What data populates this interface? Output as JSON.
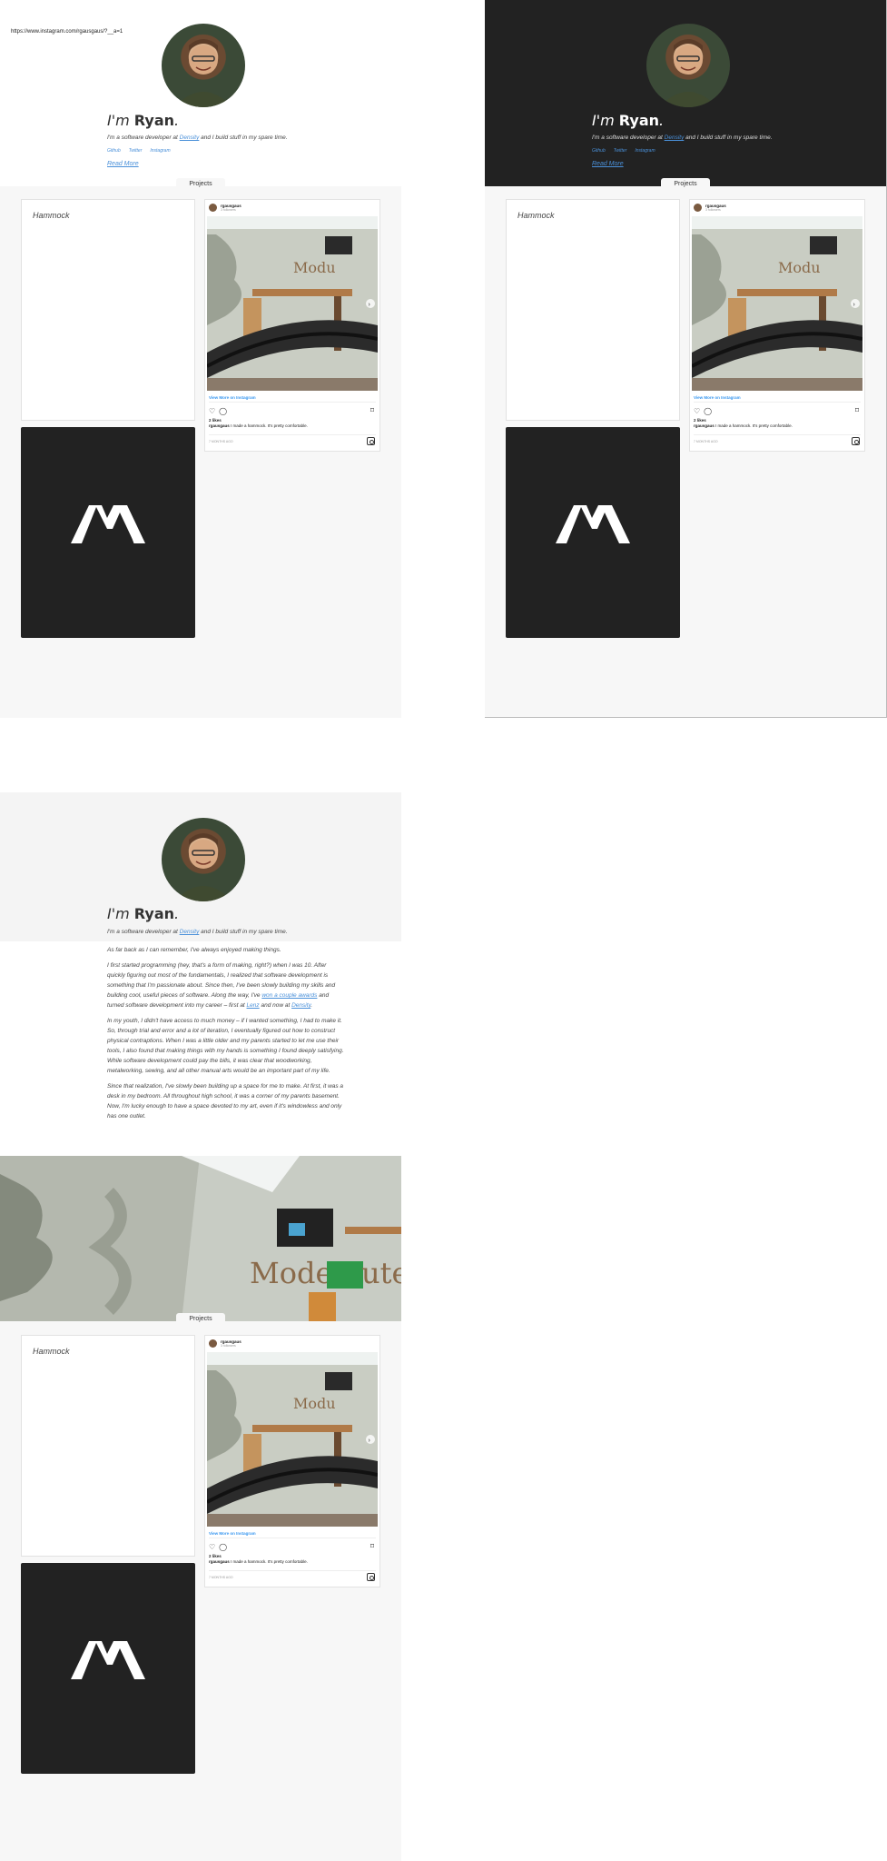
{
  "url": "https://www.instagram.com/rgausgaus/?__a=1",
  "intro": {
    "prefix": "I'm ",
    "name": "Ryan",
    "suffix": ".",
    "text_before": "I'm a software developer at ",
    "company": "Density",
    "text_after": " and I build stuff in my spare time."
  },
  "social": [
    "Github",
    "Twitter",
    "Instagram"
  ],
  "read_more": "Read More",
  "projects_tab": "Projects",
  "hammock_label": "Hammock",
  "instagram": {
    "username": "rgausgaus",
    "followers": "3 followers",
    "view_more": "View More on Instagram",
    "likes": "2 likes",
    "caption_user": "rgausgaus",
    "caption_text": " I made a hammock. It's pretty comfortable.",
    "time": "7 MONTHS AGO",
    "icons": [
      "heart-icon",
      "comment-icon",
      "bookmark-icon",
      "instagram-icon",
      "chevron-right-icon"
    ]
  },
  "about": {
    "p1": "As far back as I can remember, I've always enjoyed making things.",
    "p2a": "I first started programming (hey, that's a form of making, right?) when I was 10. After quickly figuring out most of the fundamentals, I realized that software development is something that I'm passionate about. Since then, I've been slowly building my skills and building cool, useful pieces of software. Along the way, I've ",
    "p2_link1": "won a couple awards",
    "p2b": " and turned software development into my career – first at ",
    "p2_link2": "Lenz",
    "p2c": " and now at ",
    "p2_link3": "Density",
    "p2d": ".",
    "p3": "In my youth, I didn't have access to much money – if I wanted something, I had to make it. So, through trial and error and a lot of iteration, I eventually figured out how to construct physical contraptions. When I was a little older and my parents started to let me use their tools, I also found that making things with my hands is something I found deeply satisfying. While software development could pay the bills, it was clear that woodworking, metalworking, sewing, and all other manual arts would be an important part of my life.",
    "p4": "Since that realization, I've slowly been building up a space for me to make. At first, it was a desk in my bedroom. All throughout high school, it was a corner of my parents basement. Now, I'm lucky enough to have a space devoted to my art, even if it's windowless and only has one outlet."
  },
  "colors": {
    "accent": "#4a90d9",
    "dark": "#222222",
    "content_bg": "#f7f7f7"
  }
}
